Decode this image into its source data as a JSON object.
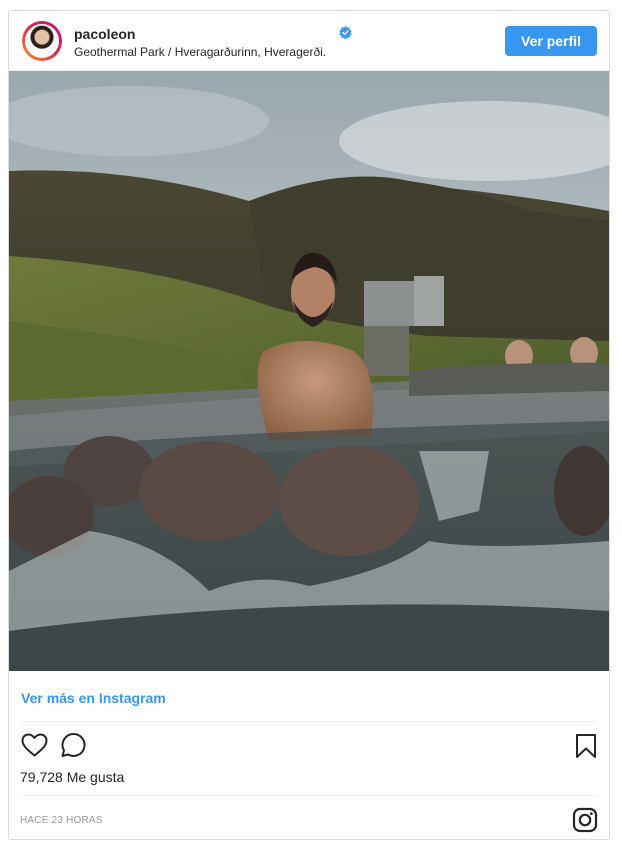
{
  "header": {
    "username": "pacoleon",
    "location": "Geothermal Park / Hveragarðurinn, Hveragerði.",
    "follow_button": "Ver perfil"
  },
  "post": {
    "image_alt": "Man bathing in a geothermal hot river among green hills"
  },
  "footer": {
    "view_more_link": "Ver más en Instagram",
    "likes": "79,728 Me gusta",
    "timestamp": "HACE 23 HORAS"
  },
  "colors": {
    "accent_blue": "#3897f0",
    "verified_blue": "#3897f0",
    "text": "#262626",
    "muted": "#999999",
    "border": "#dbdbdb"
  },
  "icons": [
    "verified-badge-icon",
    "heart-icon",
    "comment-icon",
    "bookmark-icon",
    "instagram-logo-icon"
  ]
}
